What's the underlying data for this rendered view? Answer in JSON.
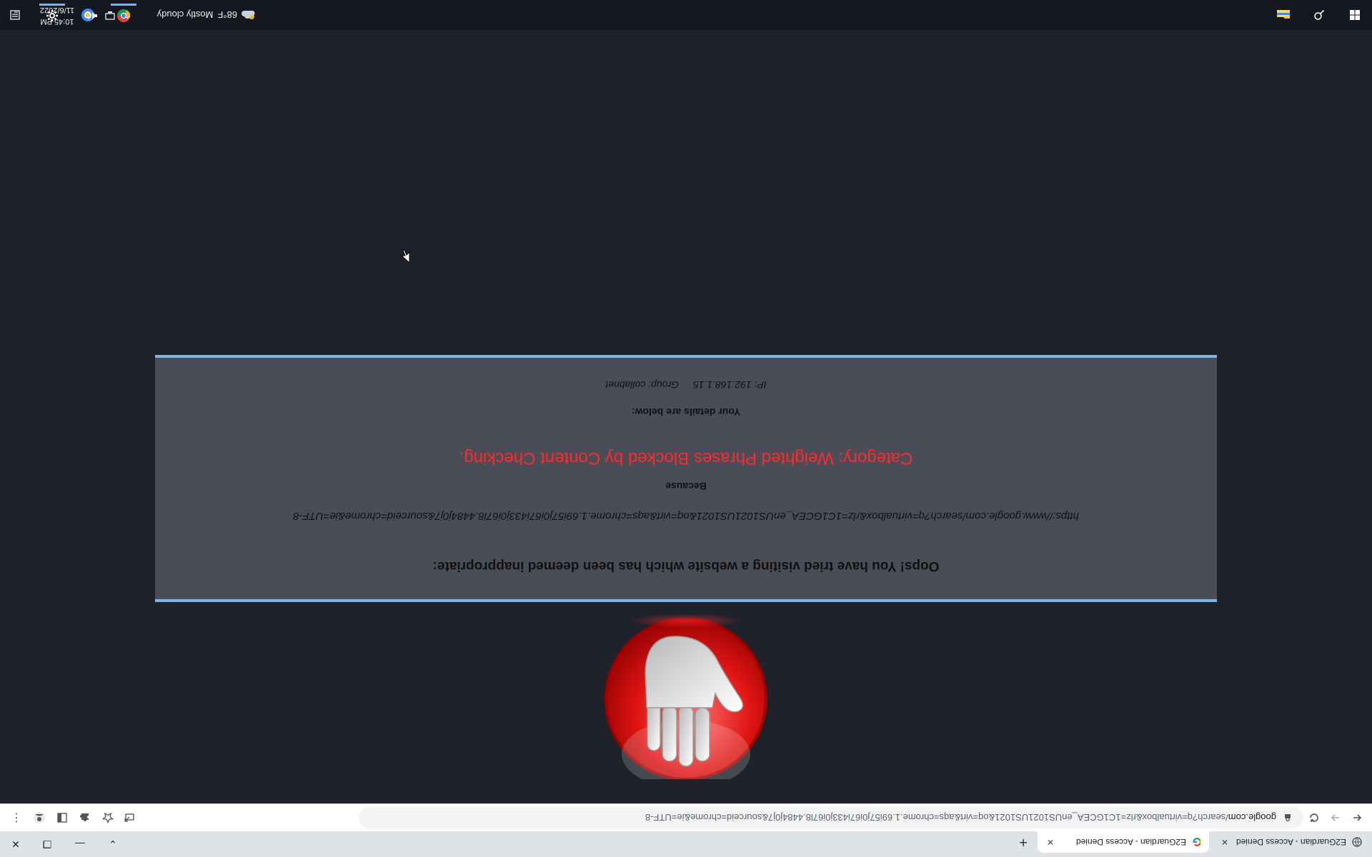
{
  "browser": {
    "tabs": [
      {
        "title": "E2Guardian - Access Denied",
        "favicon": "globe-icon"
      },
      {
        "title": "E2Guardian - Access Denied",
        "favicon": "google-icon"
      }
    ],
    "new_tab_label": "+",
    "window_controls": {
      "collapse": "⌄",
      "minimize": "—",
      "restore": "❐",
      "close": "✕"
    },
    "url_host": "google.com",
    "url_path": "/search?q=virtualbox&rlz=1C1GCEA_enUS1021US1021&oq=virt&aqs=chrome.1.69i57j0i67i433j0i67l8.4484j0j7&sourceid=chrome&ie=UTF-8"
  },
  "page": {
    "oops_text": "Oops! You have tried visiting a website which has been deemed inappropriate:",
    "blocked_url": "https://www.google.com/search?q=virtualbox&rlz=1C1GCEA_enUS1021US1021&oq=virt&aqs=chrome.1.69i57j0i67i433j0i67l8.4484j0j7&sourceid=chrome&ie=UTF-8",
    "because_label": "Because",
    "category_text": "Category: Weighted Phrases  Blocked by Content Checking.",
    "details_label": "Your details are below:",
    "group_text": "Group: collabnet",
    "ip_text": "IP: 192.168.1.15"
  },
  "taskbar": {
    "weather_temp": "68°F",
    "weather_desc": "Mostly cloudy",
    "time": "10:45 PM",
    "date": "11/6/2022",
    "tray_chevron": "⌃"
  },
  "colors": {
    "page_bg": "#1f222b",
    "panel_bg": "#4a4d57",
    "panel_border": "#7fb5e6",
    "category_red": "#ff2a2a",
    "taskbar_bg": "#151820"
  }
}
